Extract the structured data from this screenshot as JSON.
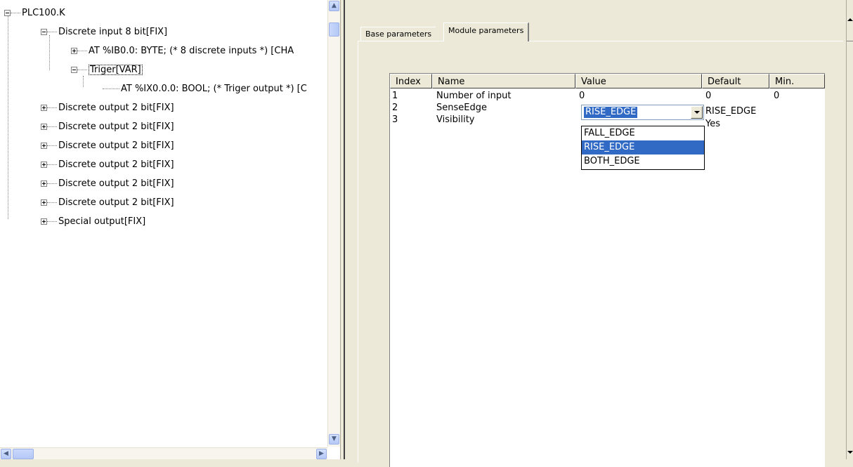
{
  "tree": {
    "root": "PLC100.K",
    "discrete_input": "Discrete input 8 bit[FIX]",
    "at_ib": "AT %IB0.0: BYTE; (* 8 discrete inputs *) [CHA",
    "triger": "Triger[VAR]",
    "at_ix": "AT %IX0.0.0: BOOL; (* Triger output *) [C",
    "outputs": [
      "Discrete output 2 bit[FIX]",
      "Discrete output 2 bit[FIX]",
      "Discrete output 2 bit[FIX]",
      "Discrete output 2 bit[FIX]",
      "Discrete output 2 bit[FIX]",
      "Discrete output 2 bit[FIX]"
    ],
    "special": "Special output[FIX]"
  },
  "tabs": {
    "base": "Base parameters",
    "module": "Module parameters"
  },
  "grid": {
    "headers": {
      "index": "Index",
      "name": "Name",
      "value": "Value",
      "default": "Default",
      "min": "Min."
    },
    "rows": [
      {
        "index": "1",
        "name": "Number of input",
        "value": "0",
        "default": "0",
        "min": "0"
      },
      {
        "index": "2",
        "name": "SenseEdge",
        "value": "RISE_EDGE",
        "default": "RISE_EDGE",
        "min": ""
      },
      {
        "index": "3",
        "name": "Visibility",
        "value": "",
        "default": "Yes",
        "min": ""
      }
    ]
  },
  "combo": {
    "selected": "RISE_EDGE",
    "options": [
      "FALL_EDGE",
      "RISE_EDGE",
      "BOTH_EDGE"
    ],
    "highlighted": "RISE_EDGE"
  },
  "icons": {
    "tree_expand": "plus-box-icon",
    "tree_collapse": "minus-box-icon",
    "scroll_up": "arrow-up-icon",
    "scroll_down": "arrow-down-icon",
    "scroll_left": "arrow-left-icon",
    "scroll_right": "arrow-right-icon",
    "dropdown": "chevron-down-icon"
  },
  "colors": {
    "selection": "#316ac5",
    "face": "#ece9d8"
  }
}
